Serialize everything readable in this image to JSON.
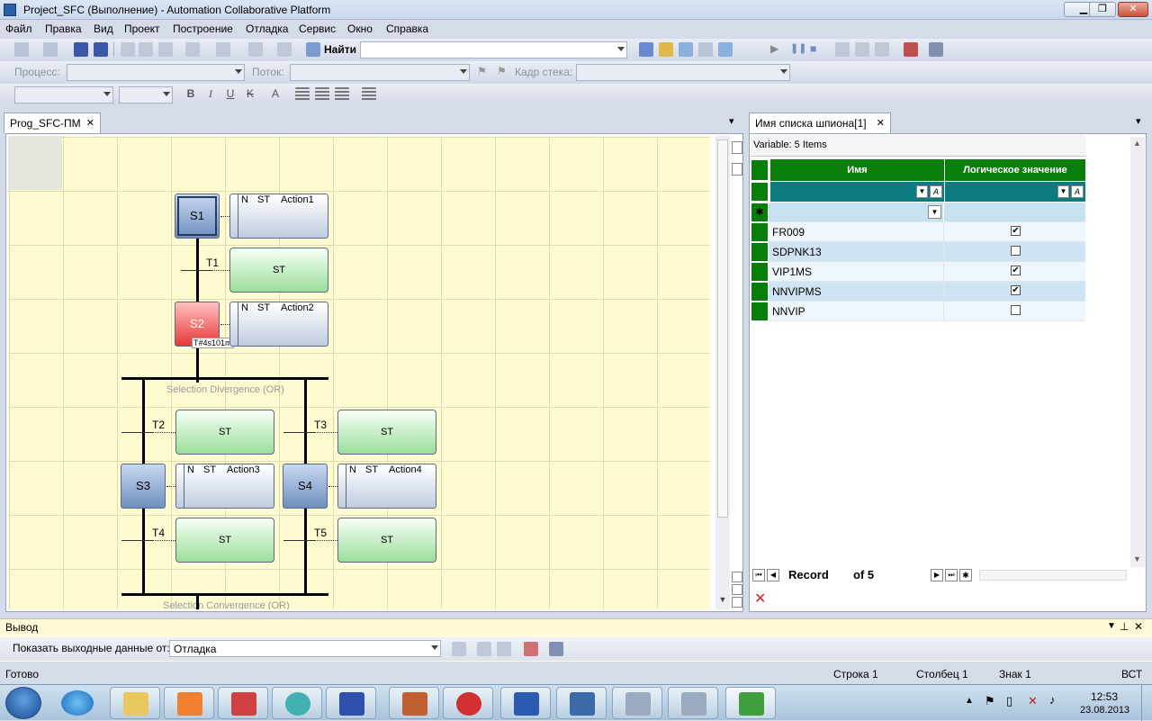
{
  "window": {
    "title": "Project_SFC (Выполнение) - Automation Collaborative Platform",
    "minimize": "▁",
    "maximize": "❐",
    "close": "✕"
  },
  "menu": [
    "Файл",
    "Правка",
    "Вид",
    "Проект",
    "Построение",
    "Отладка",
    "Сервис",
    "Окно",
    "Справка"
  ],
  "toolbar": {
    "find_label": "Найти",
    "find_value": "",
    "process_label": "Процесс:",
    "thread_label": "Поток:",
    "stack_label": "Кадр стека:",
    "bold": "B",
    "italic": "I",
    "underline": "U",
    "strike": "K",
    "fontA": "A"
  },
  "doc": {
    "tab": "Prog_SFC-ПМ",
    "close": "✕",
    "menu": "▾"
  },
  "sfc": {
    "steps": [
      {
        "name": "S1"
      },
      {
        "name": "S2"
      },
      {
        "name": "S3"
      },
      {
        "name": "S4"
      }
    ],
    "actions": [
      {
        "q": "N",
        "lang": "ST",
        "name": "Action1"
      },
      {
        "q": "N",
        "lang": "ST",
        "name": "Action2"
      },
      {
        "q": "N",
        "lang": "ST",
        "name": "Action3"
      },
      {
        "q": "N",
        "lang": "ST",
        "name": "Action4"
      }
    ],
    "transitions": [
      {
        "name": "T1",
        "body": "ST"
      },
      {
        "name": "T2",
        "body": "ST"
      },
      {
        "name": "T3",
        "body": "ST"
      },
      {
        "name": "T4",
        "body": "ST"
      },
      {
        "name": "T5",
        "body": "ST"
      }
    ],
    "timer": "T#4s101m",
    "divergence": "Selection Divergence (OR)",
    "convergence": "Selection Convergence (OR)"
  },
  "spy": {
    "tab": "Имя списка шпиона[1]",
    "close": "✕",
    "summary": "Variable: 5 Items",
    "col_name": "Имя",
    "col_value": "Логическое значение",
    "rows": [
      {
        "name": "FR009",
        "value": "✔"
      },
      {
        "name": "SDPNK13",
        "value": ""
      },
      {
        "name": "VIP1MS",
        "value": "✔"
      },
      {
        "name": "NNVIPMS",
        "value": "✔"
      },
      {
        "name": "NNVIP",
        "value": ""
      }
    ],
    "nav": {
      "record": "Record",
      "of": "of 5",
      "first": "⏮",
      "prev": "◀",
      "next": "▶",
      "last": "⏭",
      "new": "✱"
    },
    "delete": "✕"
  },
  "output": {
    "title": "Вывод",
    "show_label": "Показать выходные данные от:",
    "source": "Отладка"
  },
  "status": {
    "ready": "Готово",
    "line": "Строка 1",
    "col": "Столбец 1",
    "char": "Знак 1",
    "ins": "ВСТ"
  },
  "clock": {
    "time": "12:53",
    "date": "23.08.2013"
  },
  "colors": {
    "grid_header": "#0a7e0a",
    "canvas": "#fffbd0",
    "active_step": "#e83838"
  }
}
